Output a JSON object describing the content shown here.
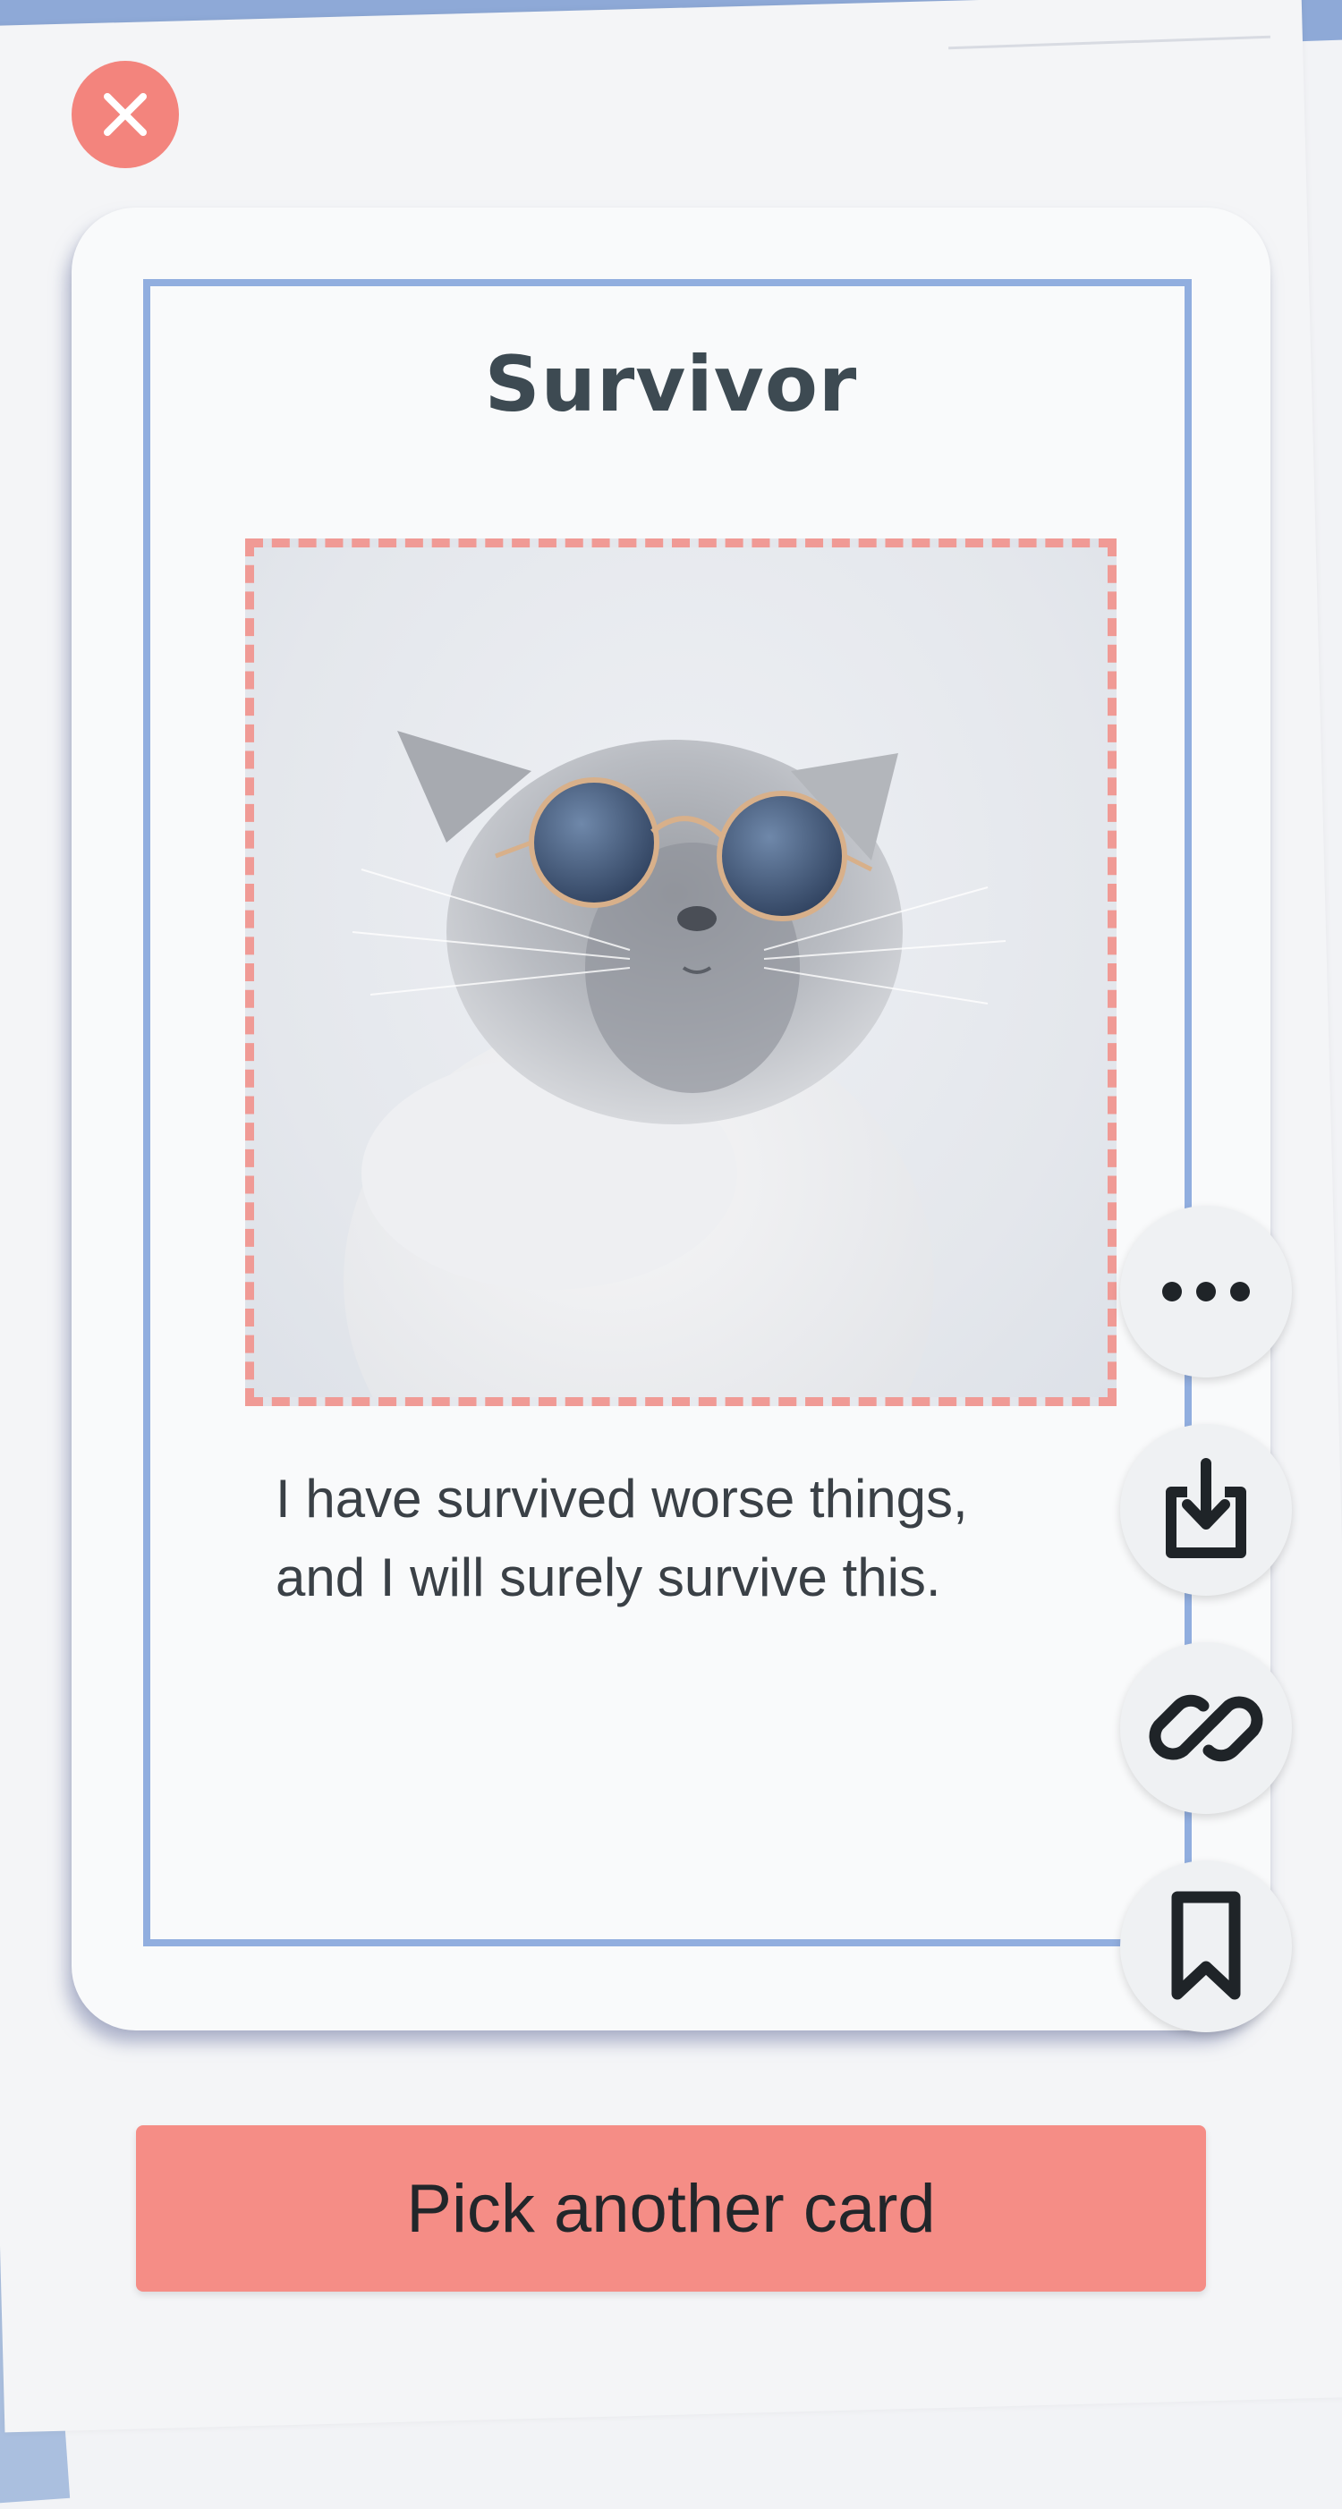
{
  "card": {
    "title": "Survivor",
    "quote_line1": "I have survived worse things,",
    "quote_line2": "and I will surely survive this.",
    "image_subject": "cat-with-sunglasses"
  },
  "actions": {
    "close_icon": "close-icon",
    "more_icon": "more-icon",
    "download_icon": "download-icon",
    "link_icon": "link-icon",
    "bookmark_icon": "bookmark-icon"
  },
  "cta": {
    "label": "Pick another card"
  },
  "colors": {
    "accent": "#f58d86",
    "frame": "#91aedf",
    "title": "#3d4a52",
    "dashed_border": "#f09a95"
  }
}
